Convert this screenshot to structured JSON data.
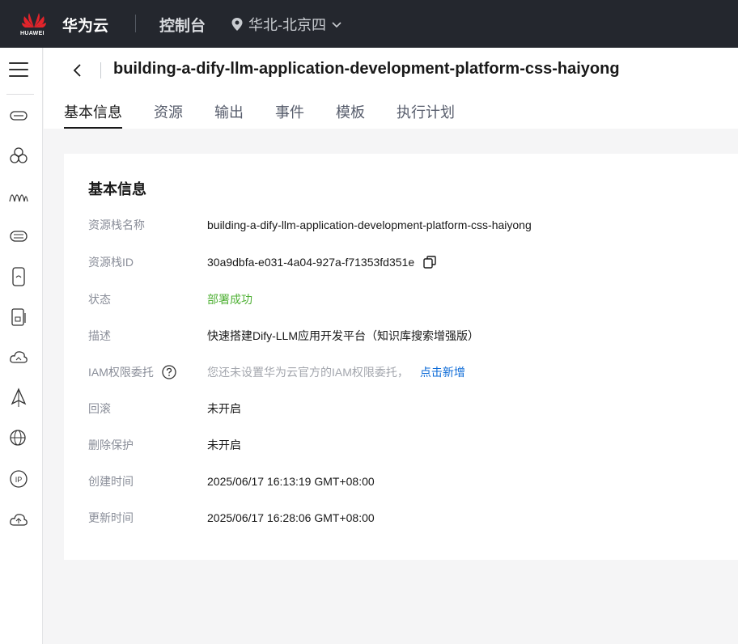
{
  "topbar": {
    "logo_text": "HUAWEI",
    "brand": "华为云",
    "console": "控制台",
    "region": "华北-北京四",
    "icons": [
      "huawei-logo",
      "location-pin-icon",
      "chevron-down-icon"
    ]
  },
  "sidebar": {
    "icons": [
      "menu-icon",
      "ecs-icon",
      "cluster-icon",
      "wave-icon",
      "disk-icon",
      "phone-icon",
      "storage-icon",
      "cloud-icon",
      "distribution-icon",
      "globe-icon",
      "ip-icon",
      "cloud-upload-icon"
    ]
  },
  "header": {
    "title": "building-a-dify-llm-application-development-platform-css-haiyong",
    "tabs": [
      "基本信息",
      "资源",
      "输出",
      "事件",
      "模板",
      "执行计划"
    ],
    "active_tab": 0
  },
  "card": {
    "title": "基本信息",
    "rows": [
      {
        "label": "资源栈名称",
        "value": "building-a-dify-llm-application-development-platform-css-haiyong"
      },
      {
        "label": "资源栈ID",
        "value": "30a9dbfa-e031-4a04-927a-f71353fd351e"
      },
      {
        "label": "状态",
        "value": "部署成功"
      },
      {
        "label": "描述",
        "value": "快速搭建Dify-LLM应用开发平台（知识库搜索增强版）"
      },
      {
        "label": "IAM权限委托",
        "value": "您还未设置华为云官方的IAM权限委托，",
        "link": "点击新增"
      },
      {
        "label": "回滚",
        "value": "未开启"
      },
      {
        "label": "删除保护",
        "value": "未开启"
      },
      {
        "label": "创建时间",
        "value": "2025/06/17 16:13:19 GMT+08:00"
      },
      {
        "label": "更新时间",
        "value": "2025/06/17 16:28:06 GMT+08:00"
      }
    ]
  },
  "colors": {
    "topbar_bg": "#24272e",
    "success": "#50b136",
    "link": "#0b6ad7",
    "logo_red": "#e3242b"
  }
}
